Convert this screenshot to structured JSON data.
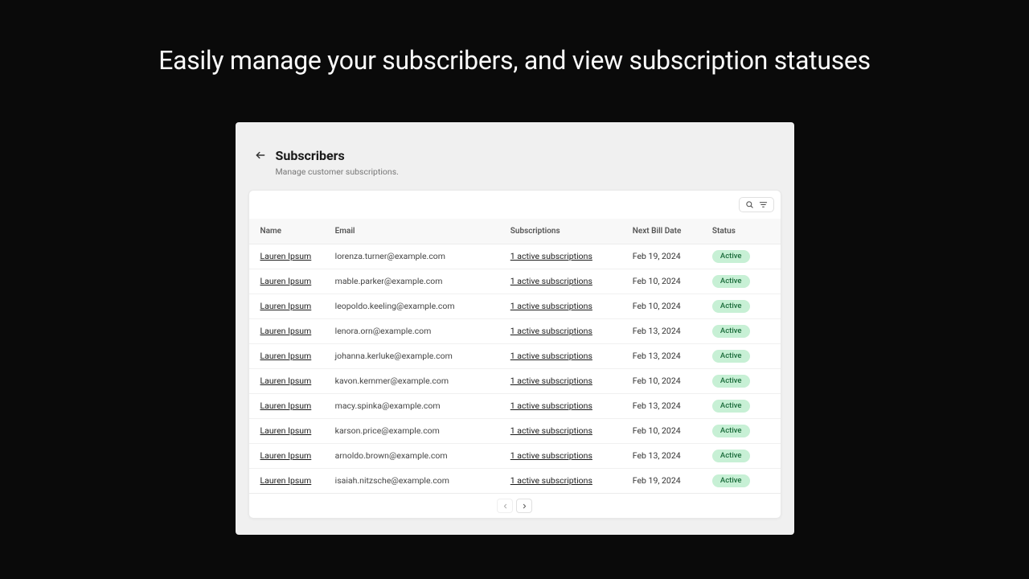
{
  "hero": "Easily manage your subscribers, and view subscription statuses",
  "page": {
    "title": "Subscribers",
    "subtitle": "Manage customer subscriptions."
  },
  "columns": {
    "name": "Name",
    "email": "Email",
    "subscriptions": "Subscriptions",
    "next_bill": "Next Bill Date",
    "status": "Status"
  },
  "rows": [
    {
      "name": "Lauren Ipsum",
      "email": "lorenza.turner@example.com",
      "subscriptions": "1 active subscriptions",
      "next_bill": "Feb 19, 2024",
      "status": "Active"
    },
    {
      "name": "Lauren Ipsum",
      "email": "mable.parker@example.com",
      "subscriptions": "1 active subscriptions",
      "next_bill": "Feb 10, 2024",
      "status": "Active"
    },
    {
      "name": "Lauren Ipsum",
      "email": "leopoldo.keeling@example.com",
      "subscriptions": "1 active subscriptions",
      "next_bill": "Feb 10, 2024",
      "status": "Active"
    },
    {
      "name": "Lauren Ipsum",
      "email": "lenora.orn@example.com",
      "subscriptions": "1 active subscriptions",
      "next_bill": "Feb 13, 2024",
      "status": "Active"
    },
    {
      "name": "Lauren Ipsum",
      "email": "johanna.kerluke@example.com",
      "subscriptions": "1 active subscriptions",
      "next_bill": "Feb 13, 2024",
      "status": "Active"
    },
    {
      "name": "Lauren Ipsum",
      "email": "kavon.kemmer@example.com",
      "subscriptions": "1 active subscriptions",
      "next_bill": "Feb 10, 2024",
      "status": "Active"
    },
    {
      "name": "Lauren Ipsum",
      "email": "macy.spinka@example.com",
      "subscriptions": "1 active subscriptions",
      "next_bill": "Feb 13, 2024",
      "status": "Active"
    },
    {
      "name": "Lauren Ipsum",
      "email": "karson.price@example.com",
      "subscriptions": "1 active subscriptions",
      "next_bill": "Feb 10, 2024",
      "status": "Active"
    },
    {
      "name": "Lauren Ipsum",
      "email": "arnoldo.brown@example.com",
      "subscriptions": "1 active subscriptions",
      "next_bill": "Feb 13, 2024",
      "status": "Active"
    },
    {
      "name": "Lauren Ipsum",
      "email": "isaiah.nitzsche@example.com",
      "subscriptions": "1 active subscriptions",
      "next_bill": "Feb 19, 2024",
      "status": "Active"
    }
  ]
}
